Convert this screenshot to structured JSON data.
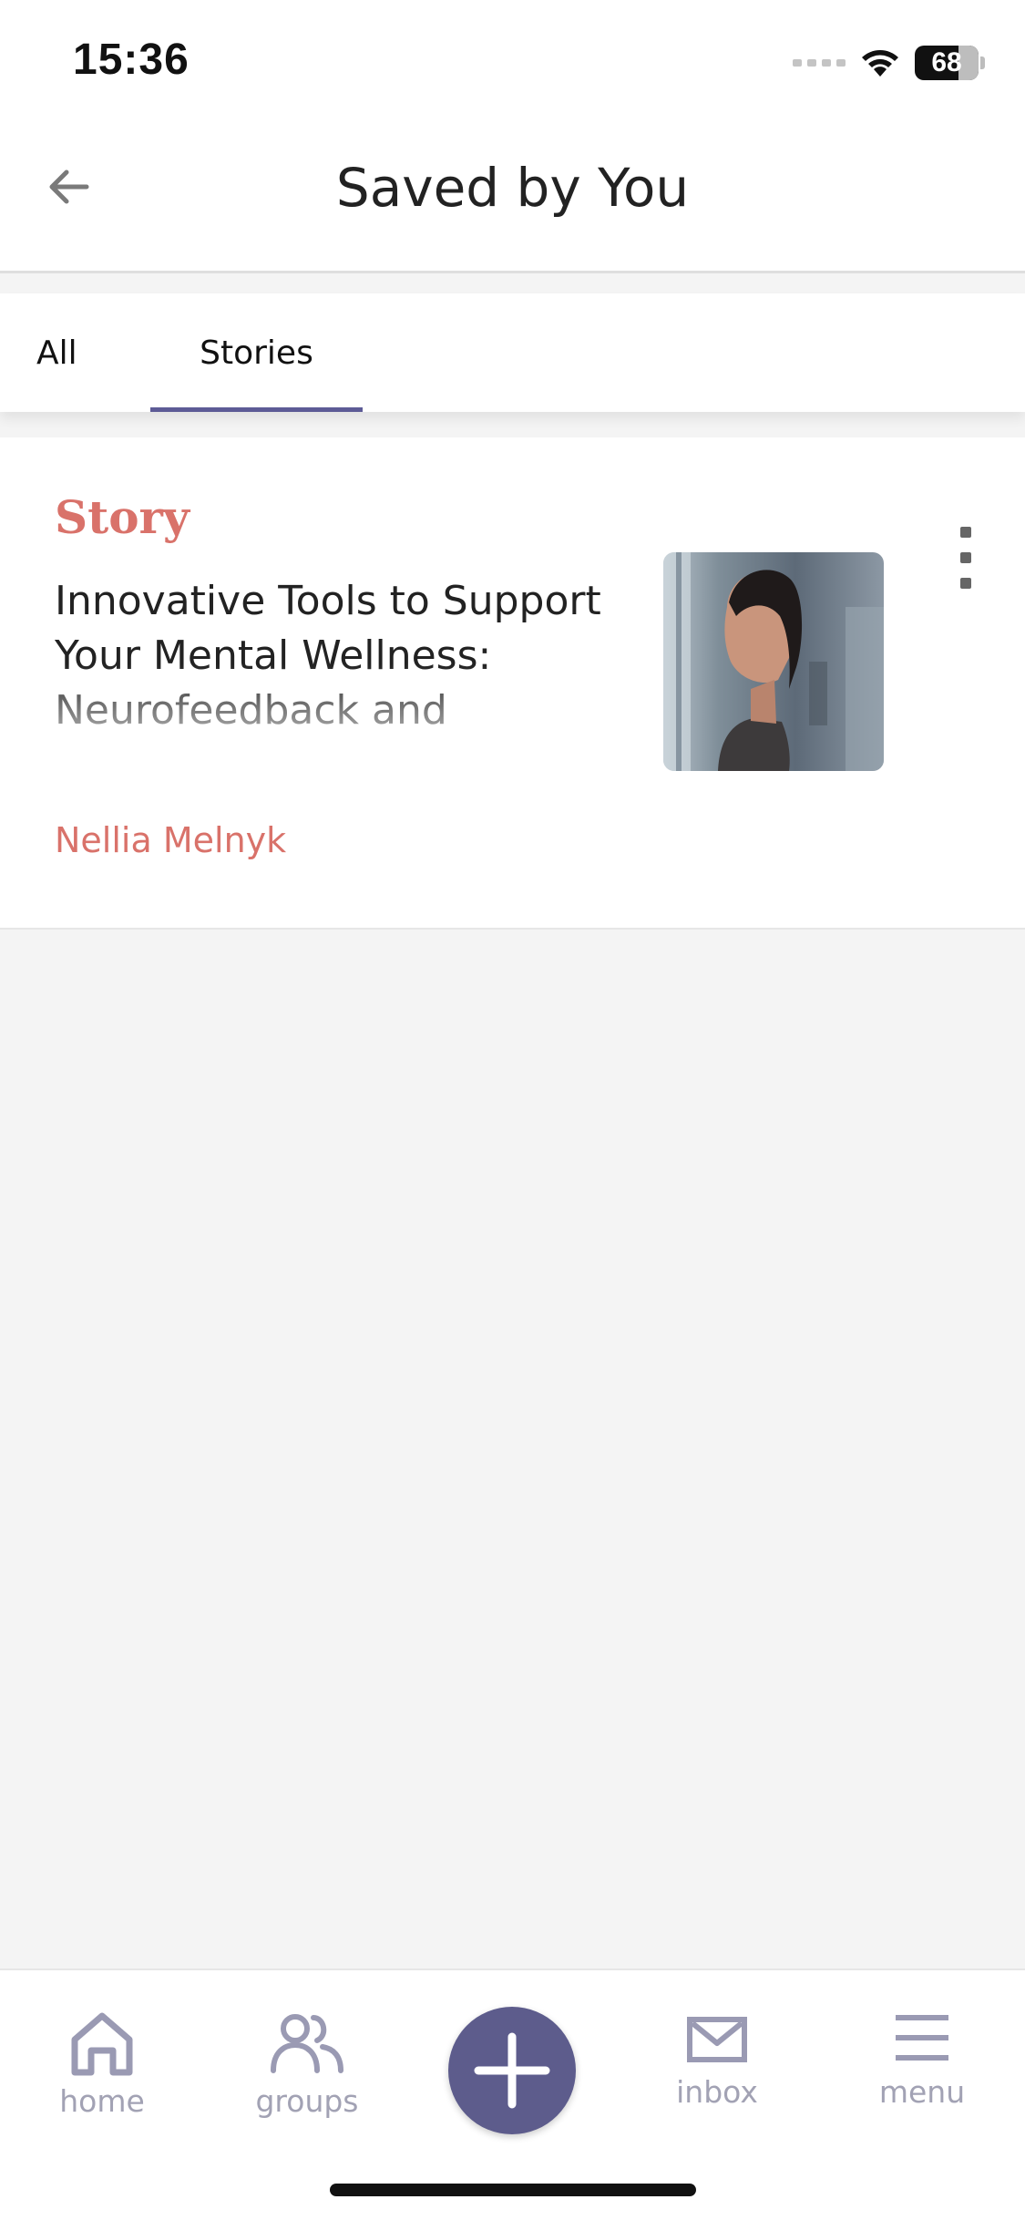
{
  "status_bar": {
    "time": "15:36",
    "battery": "68"
  },
  "header": {
    "title": "Saved by You",
    "back_icon": "arrow-left-icon"
  },
  "tabs": [
    {
      "label": "All",
      "active": false
    },
    {
      "label": "Stories",
      "active": true
    }
  ],
  "story": {
    "type_label": "Story",
    "title": "Innovative Tools to Support Your Mental Wellness: Neurofeedback and",
    "author": "Nellia Melnyk",
    "thumbnail_icon": "woman-portrait-image",
    "more_icon": "more-vertical-icon"
  },
  "bottom_nav": {
    "home": "home",
    "groups": "groups",
    "inbox": "inbox",
    "menu": "menu"
  },
  "colors": {
    "accent": "#5d5b96",
    "story_accent": "#d9726a",
    "nav_icon": "#9a9ab3"
  }
}
